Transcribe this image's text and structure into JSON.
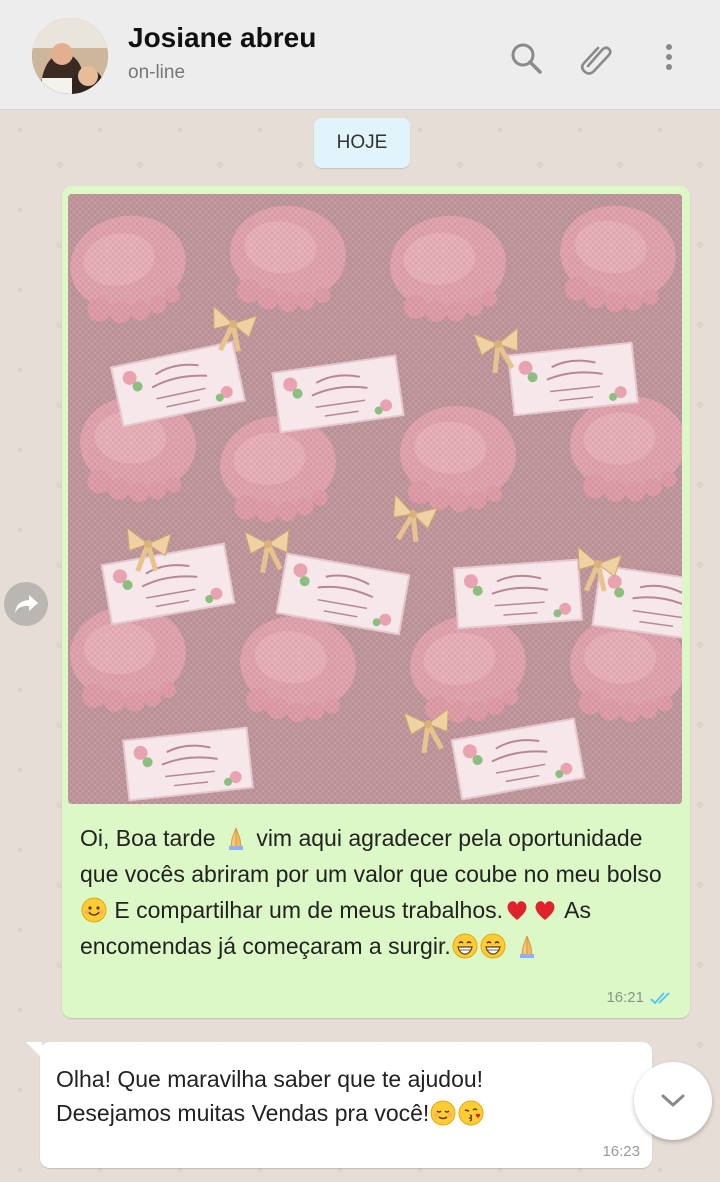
{
  "header": {
    "contact_name": "Josiane abreu",
    "status": "on-line",
    "icons": [
      "search-icon",
      "attach-icon",
      "menu-icon"
    ]
  },
  "chat": {
    "date_label": "HOJE",
    "messages": [
      {
        "direction": "outgoing",
        "has_image": true,
        "text_segments": [
          "Oi, Boa tarde",
          "vim aqui agradecer pela oportunidade que vocês abriram por um valor que coube no meu bolso",
          "E compartilhar um de meus trabalhos.",
          "As encomendas já começaram a surgir."
        ],
        "emojis": [
          "folded-hands",
          "smiling-face",
          "red-heart",
          "red-heart",
          "grinning-face",
          "grinning-face",
          "folded-hands"
        ],
        "time": "16:21",
        "status": "read"
      },
      {
        "direction": "incoming",
        "line1": "Olha! Que maravilha saber que te ajudou!",
        "line2": "Desejamos muitas Vendas pra você!",
        "emojis": [
          "relieved-face",
          "face-blowing-kiss"
        ],
        "time": "16:23"
      }
    ]
  },
  "colors": {
    "outgoing_bubble": "#dcf8c6",
    "incoming_bubble": "#ffffff",
    "read_ticks": "#4fc3f7",
    "header_bg": "#ededed"
  }
}
